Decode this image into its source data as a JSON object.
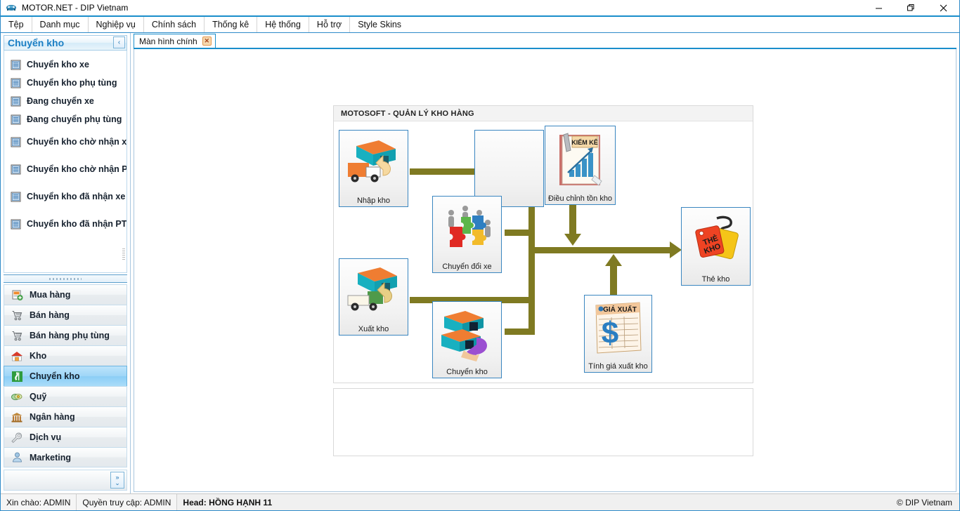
{
  "window": {
    "title": "MOTOR.NET - DIP Vietnam",
    "icon": "car-icon",
    "controls": {
      "minimize": "—",
      "maximize": "❐",
      "close": "✕"
    }
  },
  "menubar": {
    "items": [
      {
        "label": "Tệp",
        "name": "menu-tep"
      },
      {
        "label": "Danh mục",
        "name": "menu-danh-muc"
      },
      {
        "label": "Nghiệp vụ",
        "name": "menu-nghiep-vu"
      },
      {
        "label": "Chính sách",
        "name": "menu-chinh-sach"
      },
      {
        "label": "Thống kê",
        "name": "menu-thong-ke"
      },
      {
        "label": "Hệ thống",
        "name": "menu-he-thong"
      },
      {
        "label": "Hỗ trợ",
        "name": "menu-ho-tro"
      },
      {
        "label": "Style Skins",
        "name": "menu-style-skins"
      }
    ]
  },
  "sidebar": {
    "header": {
      "title": "Chuyển kho",
      "collapse_icon": "‹"
    },
    "items": [
      {
        "label": "Chuyển kho xe",
        "icon": "list-icon"
      },
      {
        "label": "Chuyển kho phụ tùng",
        "icon": "list-icon"
      },
      {
        "label": "Đang chuyển xe",
        "icon": "list-icon"
      },
      {
        "label": "Đang chuyển phụ tùng",
        "icon": "list-icon"
      },
      {
        "label": "Chuyển kho chờ nhận xe",
        "icon": "list-icon"
      },
      {
        "label": "Chuyển kho chờ nhận PT",
        "icon": "list-icon"
      },
      {
        "label": "Chuyển kho đã nhận xe",
        "icon": "list-icon"
      },
      {
        "label": "Chuyển kho đã nhận PT",
        "icon": "list-icon"
      }
    ],
    "nav": [
      {
        "label": "Mua hàng",
        "icon": "purchase-icon",
        "active": false
      },
      {
        "label": "Bán hàng",
        "icon": "cart-icon",
        "active": false
      },
      {
        "label": "Bán hàng phụ tùng",
        "icon": "cart-icon",
        "active": false
      },
      {
        "label": "Kho",
        "icon": "warehouse-icon",
        "active": false
      },
      {
        "label": "Chuyển kho",
        "icon": "transfer-icon",
        "active": true
      },
      {
        "label": "Quỹ",
        "icon": "money-icon",
        "active": false
      },
      {
        "label": "Ngân hàng",
        "icon": "bank-icon",
        "active": false
      },
      {
        "label": "Dịch vụ",
        "icon": "wrench-icon",
        "active": false
      },
      {
        "label": "Marketing",
        "icon": "person-icon",
        "active": false
      }
    ],
    "expand_icon": "»"
  },
  "tabs": [
    {
      "label": "Màn hình chính",
      "close": "✕",
      "active": true
    }
  ],
  "diagram": {
    "panel_title": "MOTOSOFT - QUẢN LÝ KHO HÀNG",
    "connector_color": "#7f7a22",
    "nodes": [
      {
        "id": "nhap-kho",
        "caption": "Nhập kho",
        "icon": "warehouse-truck-in-icon"
      },
      {
        "id": "xuat-kho",
        "caption": "Xuất kho",
        "icon": "warehouse-truck-out-icon"
      },
      {
        "id": "chuyen-doi-xe",
        "caption": "Chuyển đổi xe",
        "icon": "puzzle-team-icon"
      },
      {
        "id": "chuyen-kho",
        "caption": "Chuyển kho",
        "icon": "warehouse-transfer-icon"
      },
      {
        "id": "dieu-chinh",
        "caption": "Điều chỉnh tồn kho",
        "icon": "inventory-book-icon",
        "badge": "KIỂM KÊ"
      },
      {
        "id": "tinh-gia",
        "caption": "Tính giá xuất kho",
        "icon": "price-sheet-icon",
        "badge": "GIÁ XUẤT"
      },
      {
        "id": "the-kho",
        "caption": "Thẻ kho",
        "icon": "stock-card-icon",
        "badge": "THẺ KHO"
      }
    ]
  },
  "statusbar": {
    "left": [
      {
        "label": "Xin chào: ADMIN",
        "bold": false
      },
      {
        "label": "Quyền truy cập: ADMIN",
        "bold": false
      },
      {
        "label": "Head: HỒNG HẠNH 11",
        "bold": true
      }
    ],
    "right": "© DIP Vietnam"
  }
}
